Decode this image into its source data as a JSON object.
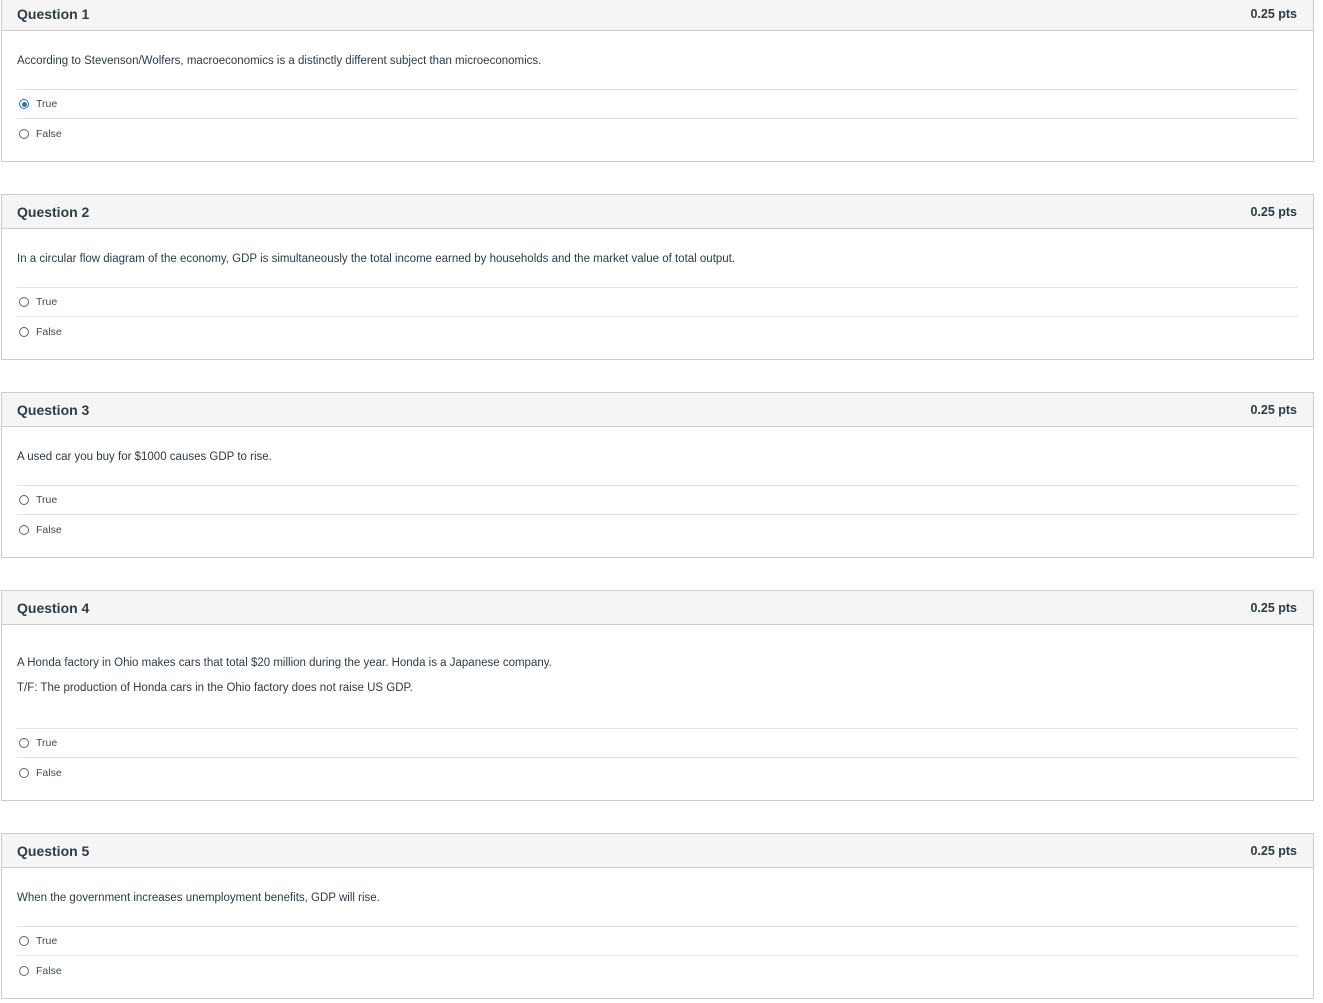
{
  "questions": [
    {
      "title": "Question 1",
      "points": "0.25 pts",
      "text": [
        "According to Stevenson/Wolfers, macroeconomics is a distinctly different subject than microeconomics."
      ],
      "answers": [
        {
          "label": "True",
          "selected": true
        },
        {
          "label": "False",
          "selected": false
        }
      ]
    },
    {
      "title": "Question 2",
      "points": "0.25 pts",
      "text": [
        "In a circular flow diagram of the economy, GDP is simultaneously the total income earned by households and the market value of total output."
      ],
      "answers": [
        {
          "label": "True",
          "selected": false
        },
        {
          "label": "False",
          "selected": false
        }
      ]
    },
    {
      "title": "Question 3",
      "points": "0.25 pts",
      "text": [
        "A used car you buy for $1000 causes GDP to rise."
      ],
      "answers": [
        {
          "label": "True",
          "selected": false
        },
        {
          "label": "False",
          "selected": false
        }
      ]
    },
    {
      "title": "Question 4",
      "points": "0.25 pts",
      "text": [
        "A Honda factory in Ohio makes cars that total $20 million during the year. Honda is a Japanese company.",
        "T/F: The production of Honda cars in the Ohio factory does not raise US GDP."
      ],
      "answers": [
        {
          "label": "True",
          "selected": false
        },
        {
          "label": "False",
          "selected": false
        }
      ]
    },
    {
      "title": "Question 5",
      "points": "0.25 pts",
      "text": [
        "When the government increases unemployment benefits, GDP will rise."
      ],
      "answers": [
        {
          "label": "True",
          "selected": false
        },
        {
          "label": "False",
          "selected": false
        }
      ]
    }
  ]
}
